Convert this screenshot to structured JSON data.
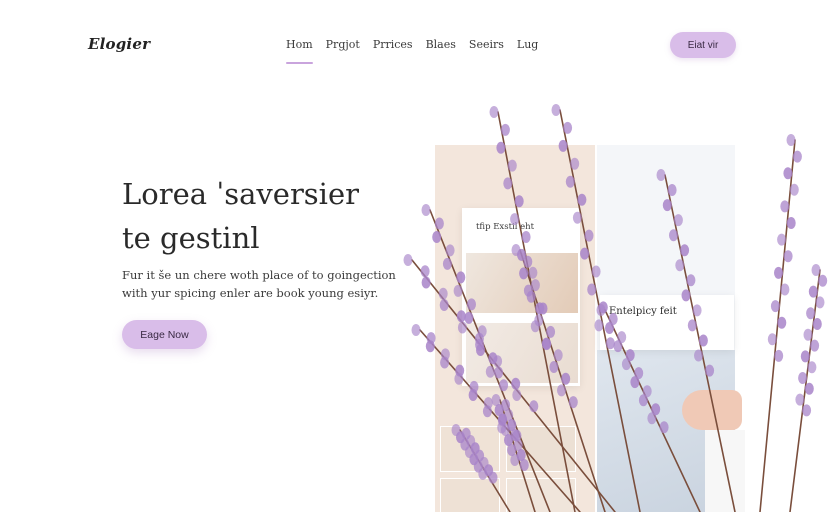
{
  "brand": {
    "logo_text": "Elogier"
  },
  "nav": {
    "items": [
      {
        "label": "Hom",
        "active": true
      },
      {
        "label": "Prgjot",
        "active": false
      },
      {
        "label": "Prrices",
        "active": false
      },
      {
        "label": "Blaes",
        "active": false
      },
      {
        "label": "Seeirs",
        "active": false
      },
      {
        "label": "Lug",
        "active": false
      }
    ],
    "cta_label": "Eiat vir"
  },
  "hero": {
    "title_lines": [
      "Lorea ˈsaversier",
      "te gestinl"
    ],
    "description_lines": [
      "Fur it še un chere woth place of to goingection",
      "with yur spicing enler are book young esiyr."
    ],
    "cta_label": "Eage Now"
  },
  "gallery": {
    "card_1_text": "tfip Exstil eht",
    "card_2_text": "Entelpicy feit"
  },
  "colors": {
    "accent": "#d9bde9",
    "accent_text": "#3a2a44",
    "lavender": "#a884c9",
    "stem": "#7a4e3c"
  }
}
